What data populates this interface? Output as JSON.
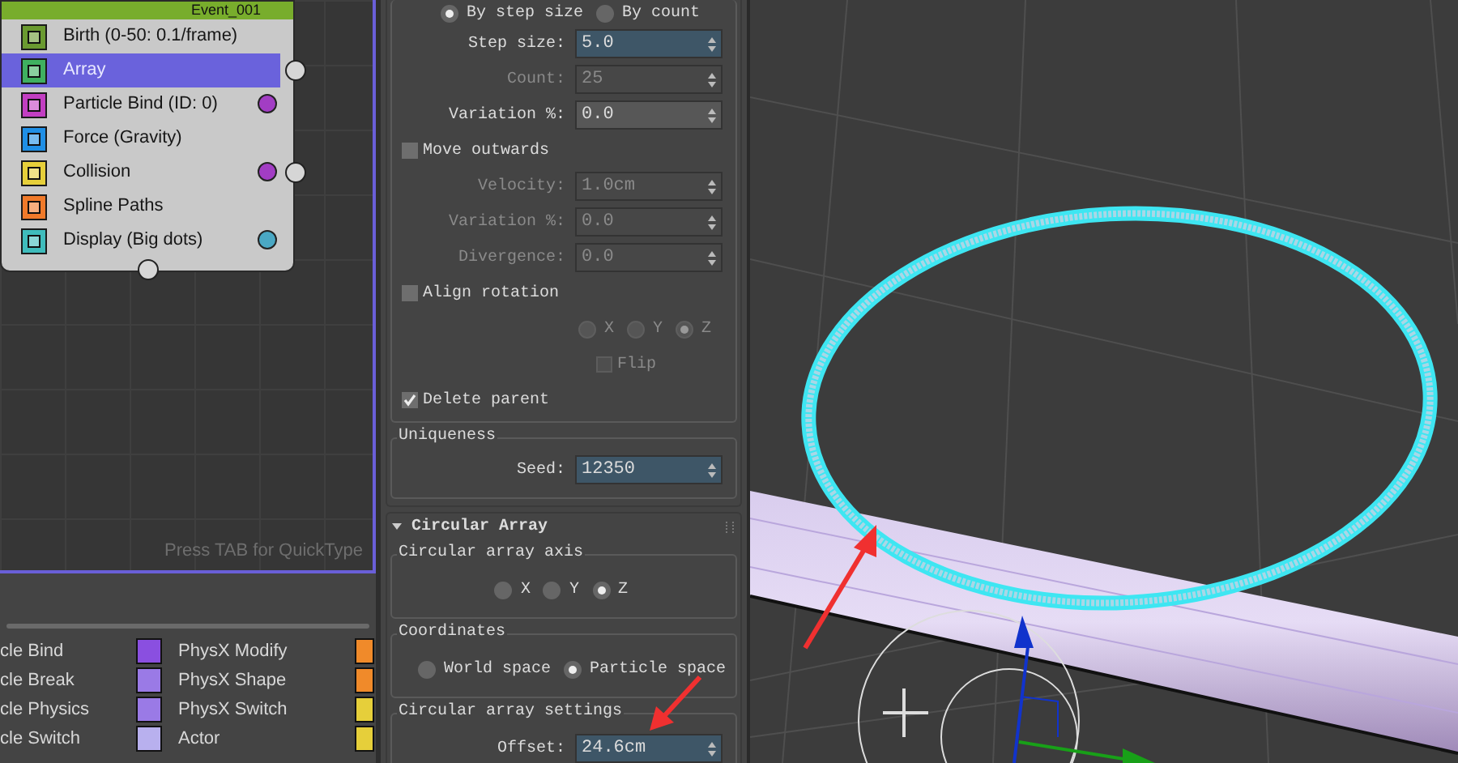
{
  "particle_view": {
    "event": {
      "title": "Event_001",
      "operators": [
        {
          "label": "Birth (0-50: 0.1/frame)",
          "selected": false,
          "output": false
        },
        {
          "label": "Array",
          "selected": true,
          "output": true
        },
        {
          "label": "Particle Bind (ID: 0)",
          "selected": false,
          "output": false,
          "color": "#a23dc4"
        },
        {
          "label": "Force (Gravity)",
          "selected": false,
          "output": false
        },
        {
          "label": "Collision",
          "selected": false,
          "output": true,
          "color": "#a23dc4"
        },
        {
          "label": "Spline Paths",
          "selected": false,
          "output": false
        },
        {
          "label": "Display (Big dots)",
          "selected": false,
          "output": false,
          "color": "#4aa8c4"
        }
      ]
    },
    "hint": "Press TAB for QuickType"
  },
  "depot": {
    "rows": [
      {
        "column_1": "cle Bind",
        "column_2": "PhysX Modify"
      },
      {
        "column_1": "cle Break",
        "column_2": "PhysX Shape"
      },
      {
        "column_1": "cle Physics",
        "column_2": "PhysX Switch"
      },
      {
        "column_1": "cle Switch",
        "column_2": "Actor"
      }
    ]
  },
  "array_rollout": {
    "rows": [
      {
        "kind": "mode_radios",
        "disabled": false,
        "options": [
          {
            "label": "By step size",
            "selected": true
          },
          {
            "label": "By count",
            "selected": false
          }
        ]
      },
      {
        "kind": "field",
        "label": "Step size:",
        "value": "5.0",
        "disabled": false,
        "highlighted": true
      },
      {
        "kind": "field",
        "label": "Count:",
        "value": "25",
        "disabled": true,
        "highlighted": false
      },
      {
        "kind": "field",
        "label": "Variation %:",
        "value": "0.0",
        "disabled": false,
        "highlighted": false
      },
      {
        "kind": "checkbox",
        "label": "Move outwards",
        "checked": false,
        "disabled": false
      },
      {
        "kind": "field",
        "label": "Velocity:",
        "value": "1.0cm",
        "disabled": true,
        "highlighted": false
      },
      {
        "kind": "field",
        "label": "Variation %:",
        "value": "0.0",
        "disabled": true,
        "highlighted": false
      },
      {
        "kind": "field",
        "label": "Divergence:",
        "value": "0.0",
        "disabled": true,
        "highlighted": false
      },
      {
        "kind": "checkbox",
        "label": "Align rotation",
        "checked": false,
        "disabled": false
      },
      {
        "kind": "axis_radios",
        "disabled": true,
        "options": [
          {
            "label": "X",
            "selected": false
          },
          {
            "label": "Y",
            "selected": false
          },
          {
            "label": "Z",
            "selected": true
          }
        ]
      },
      {
        "kind": "sub_checkbox",
        "label": "Flip",
        "checked": false,
        "disabled": true
      },
      {
        "kind": "checkbox",
        "label": "Delete parent",
        "checked": true,
        "disabled": false
      }
    ],
    "uniqueness": {
      "title": "Uniqueness",
      "rows": [
        {
          "kind": "field",
          "label": "Seed:",
          "value": "12350",
          "disabled": false,
          "highlighted": true
        }
      ]
    }
  },
  "circular_array_rollout": {
    "title": "Circular Array",
    "expanded": true,
    "groups": [
      {
        "title": "Circular array axis",
        "rows": [
          {
            "kind": "axis_radios",
            "disabled": false,
            "options": [
              {
                "label": "X",
                "selected": false
              },
              {
                "label": "Y",
                "selected": false
              },
              {
                "label": "Z",
                "selected": true
              }
            ]
          }
        ]
      },
      {
        "title": "Coordinates",
        "rows": [
          {
            "kind": "mode_radios",
            "disabled": false,
            "options": [
              {
                "label": "World space",
                "selected": false
              },
              {
                "label": "Particle space",
                "selected": true
              }
            ]
          }
        ]
      },
      {
        "title": "Circular array settings",
        "rows": [
          {
            "kind": "field",
            "label": "Offset:",
            "value": "24.6cm",
            "disabled": false,
            "highlighted": true
          }
        ]
      }
    ]
  }
}
